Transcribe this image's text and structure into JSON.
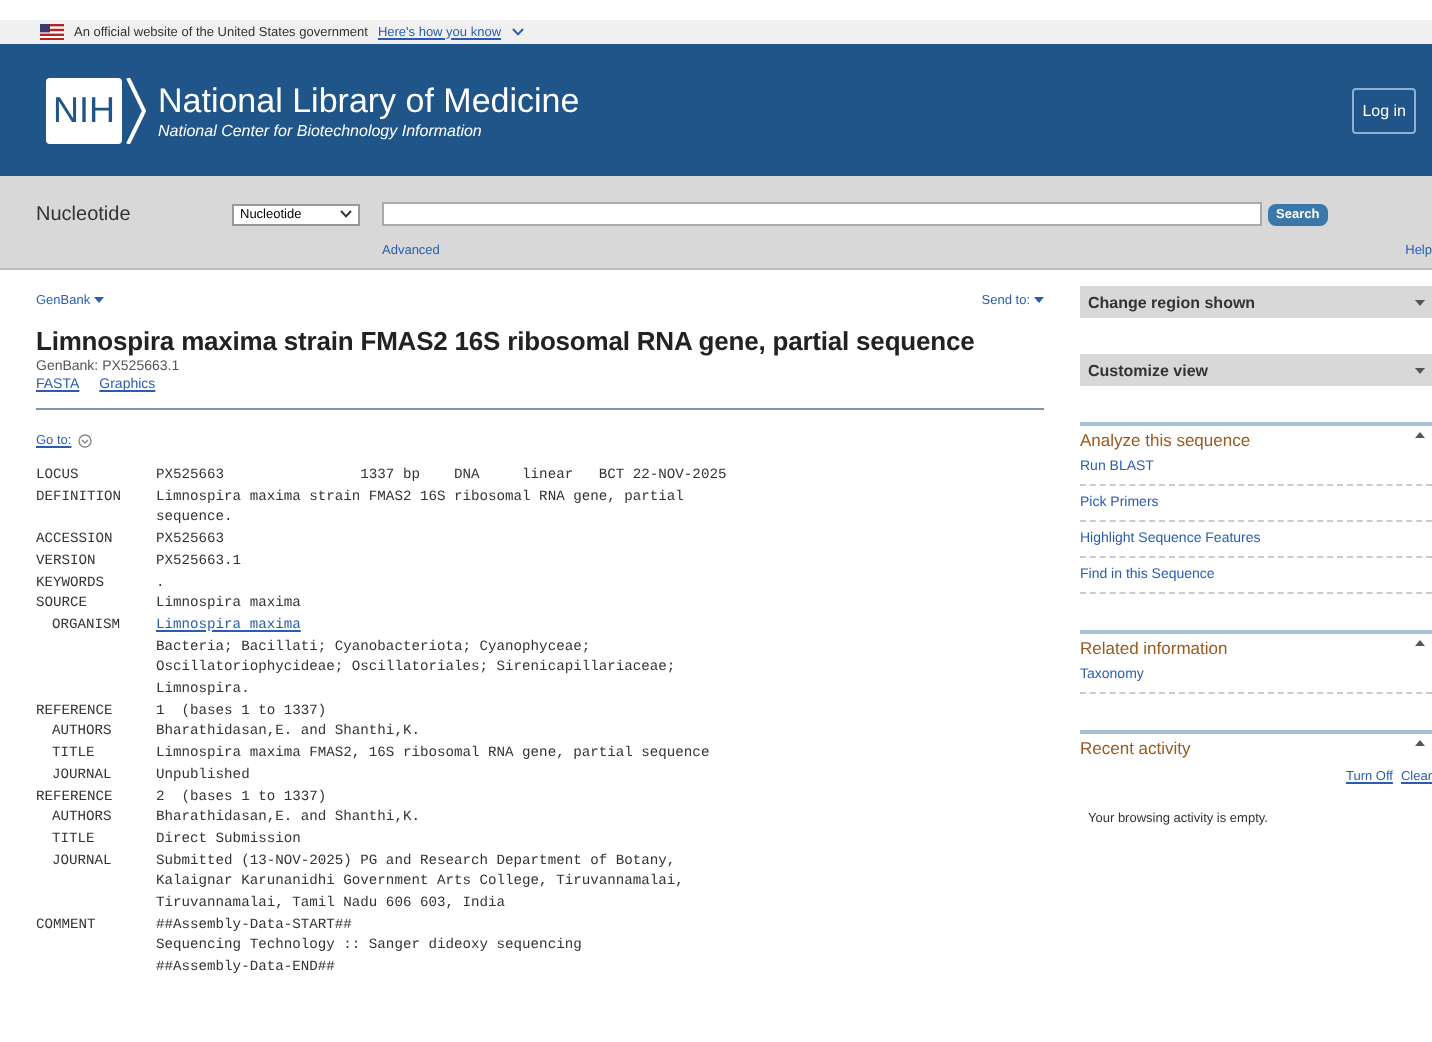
{
  "gov_banner": {
    "text": "An official website of the United States government",
    "link": "Here's how you know"
  },
  "header": {
    "logo": "NIH",
    "title": "National Library of Medicine",
    "subtitle": "National Center for Biotechnology Information",
    "login": "Log in"
  },
  "search_bar": {
    "database_label": "Nucleotide",
    "database_select": "Nucleotide",
    "search_button": "Search",
    "advanced": "Advanced",
    "help": "Help"
  },
  "record": {
    "format": "GenBank",
    "send_to": "Send to:",
    "title": "Limnospira maxima strain FMAS2 16S ribosomal RNA gene, partial sequence",
    "accession_line": "GenBank: PX525663.1",
    "links": [
      "FASTA",
      "Graphics"
    ],
    "goto": "Go to:",
    "fields": [
      {
        "key": "LOCUS",
        "link": false,
        "lines": [
          "PX525663                1337 bp    DNA     linear   BCT 22-NOV-2025"
        ]
      },
      {
        "key": "DEFINITION",
        "link": false,
        "lines": [
          "Limnospira maxima strain FMAS2 16S ribosomal RNA gene, partial",
          "sequence."
        ]
      },
      {
        "key": "ACCESSION",
        "link": false,
        "lines": [
          "PX525663"
        ]
      },
      {
        "key": "VERSION",
        "link": false,
        "lines": [
          "PX525663.1"
        ]
      },
      {
        "key": "KEYWORDS",
        "link": false,
        "lines": [
          "."
        ]
      },
      {
        "key": "SOURCE",
        "link": false,
        "lines": [
          "Limnospira maxima"
        ],
        "children": [
          {
            "key": "ORGANISM",
            "link": true,
            "lines": [
              "Limnospira maxima"
            ]
          },
          {
            "link": false,
            "lines": [
              "Bacteria; Bacillati; Cyanobacteriota; Cyanophyceae;",
              "Oscillatoriophycideae; Oscillatoriales; Sirenicapillariaceae;",
              "Limnospira."
            ]
          }
        ]
      },
      {
        "key": "REFERENCE",
        "link": false,
        "lines": [
          "1  (bases 1 to 1337)"
        ],
        "children": [
          {
            "key": "AUTHORS",
            "link": false,
            "lines": [
              "Bharathidasan,E. and Shanthi,K."
            ]
          },
          {
            "key": "TITLE",
            "link": false,
            "lines": [
              "Limnospira maxima FMAS2, 16S ribosomal RNA gene, partial sequence"
            ]
          },
          {
            "key": "JOURNAL",
            "link": false,
            "lines": [
              "Unpublished"
            ]
          }
        ]
      },
      {
        "key": "REFERENCE",
        "link": false,
        "lines": [
          "2  (bases 1 to 1337)"
        ],
        "children": [
          {
            "key": "AUTHORS",
            "link": false,
            "lines": [
              "Bharathidasan,E. and Shanthi,K."
            ]
          },
          {
            "key": "TITLE",
            "link": false,
            "lines": [
              "Direct Submission"
            ]
          },
          {
            "key": "JOURNAL",
            "link": false,
            "lines": [
              "Submitted (13-NOV-2025) PG and Research Department of Botany,",
              "Kalaignar Karunanidhi Government Arts College, Tiruvannamalai,",
              "Tiruvannamalai, Tamil Nadu 606 603, India"
            ]
          }
        ]
      },
      {
        "key": "COMMENT",
        "link": false,
        "lines": [
          "##Assembly-Data-START##",
          "Sequencing Technology :: Sanger dideoxy sequencing",
          "##Assembly-Data-END##"
        ]
      }
    ]
  },
  "sidebar": {
    "panels": [
      {
        "title": "Change region shown",
        "expanded": false
      },
      {
        "title": "Customize view",
        "expanded": false
      }
    ],
    "sections": [
      {
        "title": "Analyze this sequence",
        "expanded": true,
        "items": [
          "Run BLAST",
          "Pick Primers",
          "Highlight Sequence Features",
          "Find in this Sequence"
        ]
      },
      {
        "title": "Related information",
        "expanded": true,
        "items": [
          "Taxonomy"
        ]
      },
      {
        "title": "Recent activity",
        "expanded": true,
        "actions": [
          "Turn Off",
          "Clear"
        ],
        "note": "Your browsing activity is empty."
      }
    ]
  }
}
